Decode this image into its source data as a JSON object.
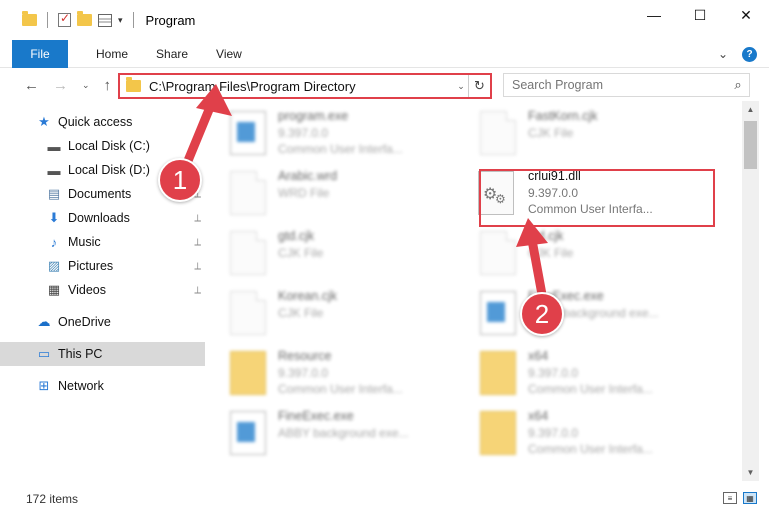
{
  "window": {
    "title": "Program",
    "controls": {
      "minimize": "—",
      "maximize": "☐",
      "close": "✕"
    }
  },
  "ribbon": {
    "tabs": [
      "File",
      "Home",
      "Share",
      "View"
    ],
    "expand_glyph": "⌄",
    "help_glyph": "?"
  },
  "navigation": {
    "back": "←",
    "forward": "→",
    "recent": "⌄",
    "up": "↑"
  },
  "address": {
    "path": "C:\\Program Files\\Program Directory",
    "dropdown": "⌄",
    "refresh": "↻"
  },
  "search": {
    "placeholder": "Search Program",
    "icon": "search-icon"
  },
  "sidebar": {
    "items": [
      {
        "label": "Quick access",
        "icon": "star-icon",
        "glyph": "★",
        "color": "#2b7bd6",
        "pinned": false
      },
      {
        "label": "Local Disk (C:)",
        "icon": "drive-icon",
        "glyph": "▬",
        "color": "#555555",
        "pinned": true
      },
      {
        "label": "Local Disk (D:)",
        "icon": "drive-icon",
        "glyph": "▬",
        "color": "#555555",
        "pinned": true
      },
      {
        "label": "Documents",
        "icon": "documents-icon",
        "glyph": "▤",
        "color": "#5b7fa6",
        "pinned": true
      },
      {
        "label": "Downloads",
        "icon": "downloads-icon",
        "glyph": "⬇",
        "color": "#2b7bd6",
        "pinned": true
      },
      {
        "label": "Music",
        "icon": "music-icon",
        "glyph": "♪",
        "color": "#2b7bd6",
        "pinned": true
      },
      {
        "label": "Pictures",
        "icon": "pictures-icon",
        "glyph": "▨",
        "color": "#4a8ab8",
        "pinned": true
      },
      {
        "label": "Videos",
        "icon": "videos-icon",
        "glyph": "▦",
        "color": "#444444",
        "pinned": true
      },
      {
        "label": "OneDrive",
        "icon": "cloud-icon",
        "glyph": "☁",
        "color": "#1a6fc9",
        "pinned": false
      },
      {
        "label": "This PC",
        "icon": "computer-icon",
        "glyph": "▭",
        "color": "#2b7bd6",
        "pinned": false
      },
      {
        "label": "Network",
        "icon": "network-icon",
        "glyph": "⊞",
        "color": "#2b7bd6",
        "pinned": false
      }
    ],
    "pin_glyph": "📌"
  },
  "files": [
    {
      "name": "program.exe",
      "meta1": "9.397.0.0",
      "meta2": "Common User Interfa...",
      "icon": "app"
    },
    {
      "name": "FastKorn.cjk",
      "meta1": "CJK File",
      "meta2": "",
      "icon": "doc"
    },
    {
      "name": "Arabic.wrd",
      "meta1": "WRD File",
      "meta2": "",
      "icon": "doc"
    },
    {
      "name": "crlui91.dll",
      "meta1": "9.397.0.0",
      "meta2": "Common User Interfa...",
      "icon": "dll"
    },
    {
      "name": "gtd.cjk",
      "meta1": "CJK File",
      "meta2": "",
      "icon": "doc"
    },
    {
      "name": "ktd.cjk",
      "meta1": "CJK File",
      "meta2": "",
      "icon": "doc"
    },
    {
      "name": "Korean.cjk",
      "meta1": "CJK File",
      "meta2": "",
      "icon": "doc"
    },
    {
      "name": "FineExec.exe",
      "meta1": "ABBY background exe...",
      "meta2": "",
      "icon": "app"
    },
    {
      "name": "Resource",
      "meta1": "9.397.0.0",
      "meta2": "Common User Interfa...",
      "icon": "folder"
    },
    {
      "name": "x64",
      "meta1": "9.397.0.0",
      "meta2": "Common User Interfa...",
      "icon": "folder"
    },
    {
      "name": "FineExec.exe",
      "meta1": "ABBY background exe...",
      "meta2": "",
      "icon": "app"
    },
    {
      "name": "x64",
      "meta1": "9.397.0.0",
      "meta2": "Common User Interfa...",
      "icon": "folder"
    }
  ],
  "status": {
    "count": "172 items"
  },
  "annotations": {
    "marker1": "1",
    "marker2": "2",
    "color": "#e0404a"
  }
}
